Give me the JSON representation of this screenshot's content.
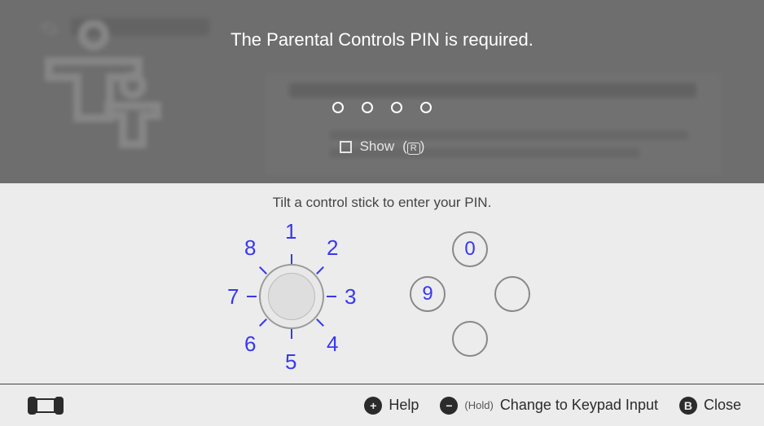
{
  "header": {
    "title": "The Parental Controls PIN is required.",
    "show_label": "Show",
    "show_button_hint": "ⓡ",
    "pin_length": 4
  },
  "instruction": "Tilt a control stick to enter your PIN.",
  "left_stick": {
    "digits": [
      "1",
      "2",
      "3",
      "4",
      "5",
      "6",
      "7",
      "8"
    ]
  },
  "right_stick": {
    "top": "0",
    "left": "9",
    "right": "",
    "down": ""
  },
  "footer": {
    "help": {
      "button": "+",
      "label": "Help"
    },
    "change": {
      "button": "−",
      "hold_prefix": "(Hold)",
      "label": "Change to Keypad Input"
    },
    "close": {
      "button": "B",
      "label": "Close"
    }
  },
  "colors": {
    "accent": "#3838f0",
    "overlay": "#6e6e6e",
    "page": "#ececec"
  }
}
